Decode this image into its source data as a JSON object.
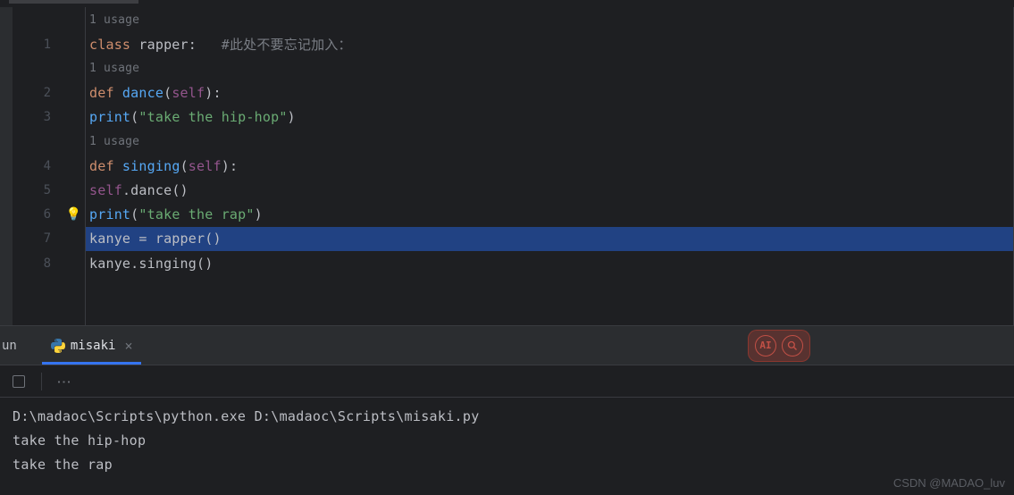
{
  "editor": {
    "usage_hint": "1 usage",
    "lines": [
      {
        "num": "1"
      },
      {
        "num": "2"
      },
      {
        "num": "3"
      },
      {
        "num": "4"
      },
      {
        "num": "5"
      },
      {
        "num": "6"
      },
      {
        "num": "7"
      },
      {
        "num": "8"
      }
    ],
    "code": {
      "l1_class": "class",
      "l1_name": " rapper",
      "l1_colon": ":",
      "l1_comment": "   #此处不要忘记加入：",
      "usage2": "1 usage",
      "l2_def": "def",
      "l2_fn": " dance",
      "l2_paren_open": "(",
      "l2_self": "self",
      "l2_paren_close": "):",
      "l3_fn": "print",
      "l3_paren_open": "(",
      "l3_str": "\"take the hip-hop\"",
      "l3_paren_close": ")",
      "usage3": "1 usage",
      "l4_def": "def",
      "l4_fn": " singing",
      "l4_paren_open": "(",
      "l4_self": "self",
      "l4_paren_close": "):",
      "l5_self": "self",
      "l5_dot": ".dance()",
      "l6_fn": "print",
      "l6_paren_open": "(",
      "l6_str": "\"take the rap\"",
      "l6_paren_close": ")",
      "l7": "kanye = rapper()",
      "l8": "kanye.singing()"
    }
  },
  "run": {
    "label": "un",
    "tab_name": "misaki",
    "close": "×"
  },
  "console": {
    "line1": "D:\\madaoc\\Scripts\\python.exe D:\\madaoc\\Scripts\\misaki.py",
    "line2": "take the hip-hop",
    "line3": "take the rap"
  },
  "watermark": "CSDN @MADAO_luv",
  "ai": {
    "label": "AI"
  }
}
